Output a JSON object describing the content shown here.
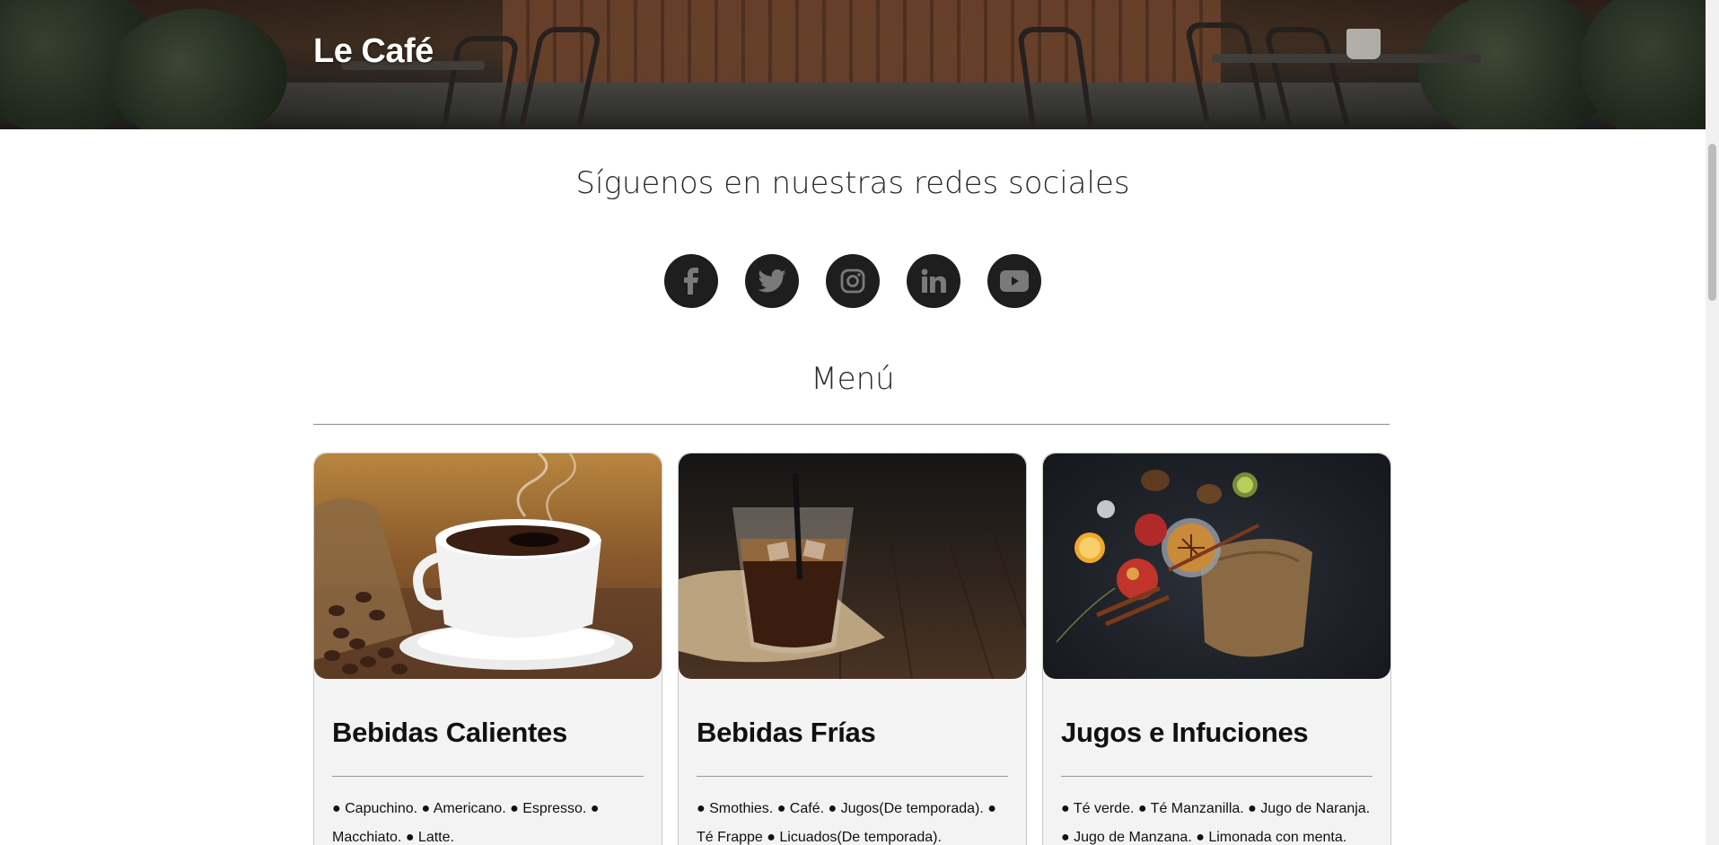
{
  "header": {
    "brand": "Le Café"
  },
  "social": {
    "title": "Síguenos en nuestras redes sociales",
    "links": [
      {
        "icon": "facebook-icon"
      },
      {
        "icon": "twitter-icon"
      },
      {
        "icon": "instagram-icon"
      },
      {
        "icon": "linkedin-icon"
      },
      {
        "icon": "youtube-icon"
      }
    ]
  },
  "menu": {
    "title": "Menú",
    "cards": [
      {
        "title": "Bebidas Calientes",
        "text": "● Capuchino. ● Americano. ● Espresso. ● Macchiato. ● Latte.",
        "image": "hot-coffee-cup-photo"
      },
      {
        "title": "Bebidas Frías",
        "text": "● Smothies. ● Café. ● Jugos(De temporada). ● Té Frappe ● Licuados(De temporada).",
        "image": "iced-coffee-glass-photo"
      },
      {
        "title": "Jugos e Infuciones",
        "text": "● Té verde. ● Té Manzanilla. ● Jugo de Naranja. ● Jugo de Manzana. ● Limonada con menta.",
        "image": "infusion-ingredients-photo"
      }
    ]
  },
  "colors": {
    "social_button": "#1e1e1e",
    "icon": "#7a7a7a",
    "card_bg": "#f3f3f3"
  }
}
